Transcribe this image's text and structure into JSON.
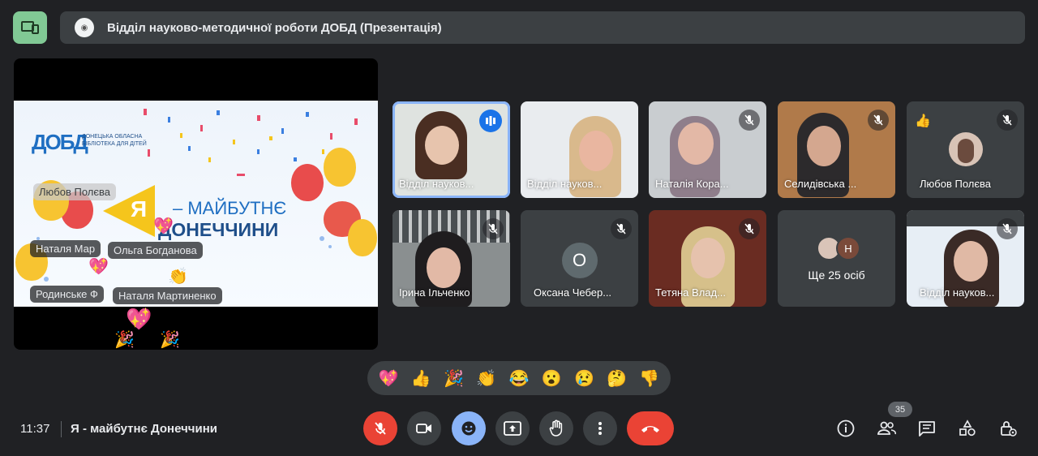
{
  "presentation": {
    "title": "Відділ науково-методичної роботи ДОБД (Презентація)"
  },
  "slide": {
    "logo": "ДОБД",
    "logo_text": "Донецька обласна бібліотека для дітей",
    "line1": "– МАЙБУТНЄ",
    "line2": "ДОНЕЧЧИНИ",
    "letter": "Я",
    "reaction_names": [
      "Любов Полєва",
      "Наталя Мар",
      "Ольга Богданова",
      "Родинське Ф",
      "Наталя Мартиненко"
    ]
  },
  "tiles": [
    {
      "name": "Відділ науков...",
      "speaking": true,
      "muted": false
    },
    {
      "name": "Відділ науков...",
      "speaking": false,
      "muted": false
    },
    {
      "name": "Наталія Кора...",
      "speaking": false,
      "muted": true
    },
    {
      "name": "Селидівська ...",
      "speaking": false,
      "muted": true
    },
    {
      "name": "Любов Полєва",
      "speaking": false,
      "muted": true,
      "reaction": "👍"
    },
    {
      "name": "Ірина Ільченко",
      "speaking": false,
      "muted": true
    },
    {
      "name": "Оксана Чебер...",
      "speaking": false,
      "muted": true,
      "initial": "О"
    },
    {
      "name": "Тетяна Влад...",
      "speaking": false,
      "muted": true
    },
    {
      "name": "Ще 25 осіб",
      "speaking": false,
      "muted": false,
      "initial": "Н"
    },
    {
      "name": "Відділ науков...",
      "speaking": false,
      "muted": true
    }
  ],
  "reactions": [
    "💖",
    "👍",
    "🎉",
    "👏",
    "😂",
    "😮",
    "😢",
    "🤔",
    "👎"
  ],
  "bottom": {
    "time": "11:37",
    "meeting_title": "Я - майбутнє Донеччини",
    "participant_count": "35"
  },
  "colors": {
    "background": "#202124",
    "surface": "#3c4043",
    "accent_blue": "#8ab4f8",
    "danger_red": "#ea4335",
    "present_green": "#81c995"
  },
  "icons": [
    "present-icon",
    "mic-off-icon",
    "camera-icon",
    "emoji-icon",
    "present-screen-icon",
    "raise-hand-icon",
    "more-icon",
    "end-call-icon",
    "info-icon",
    "people-icon",
    "chat-icon",
    "activities-icon",
    "host-controls-icon"
  ]
}
